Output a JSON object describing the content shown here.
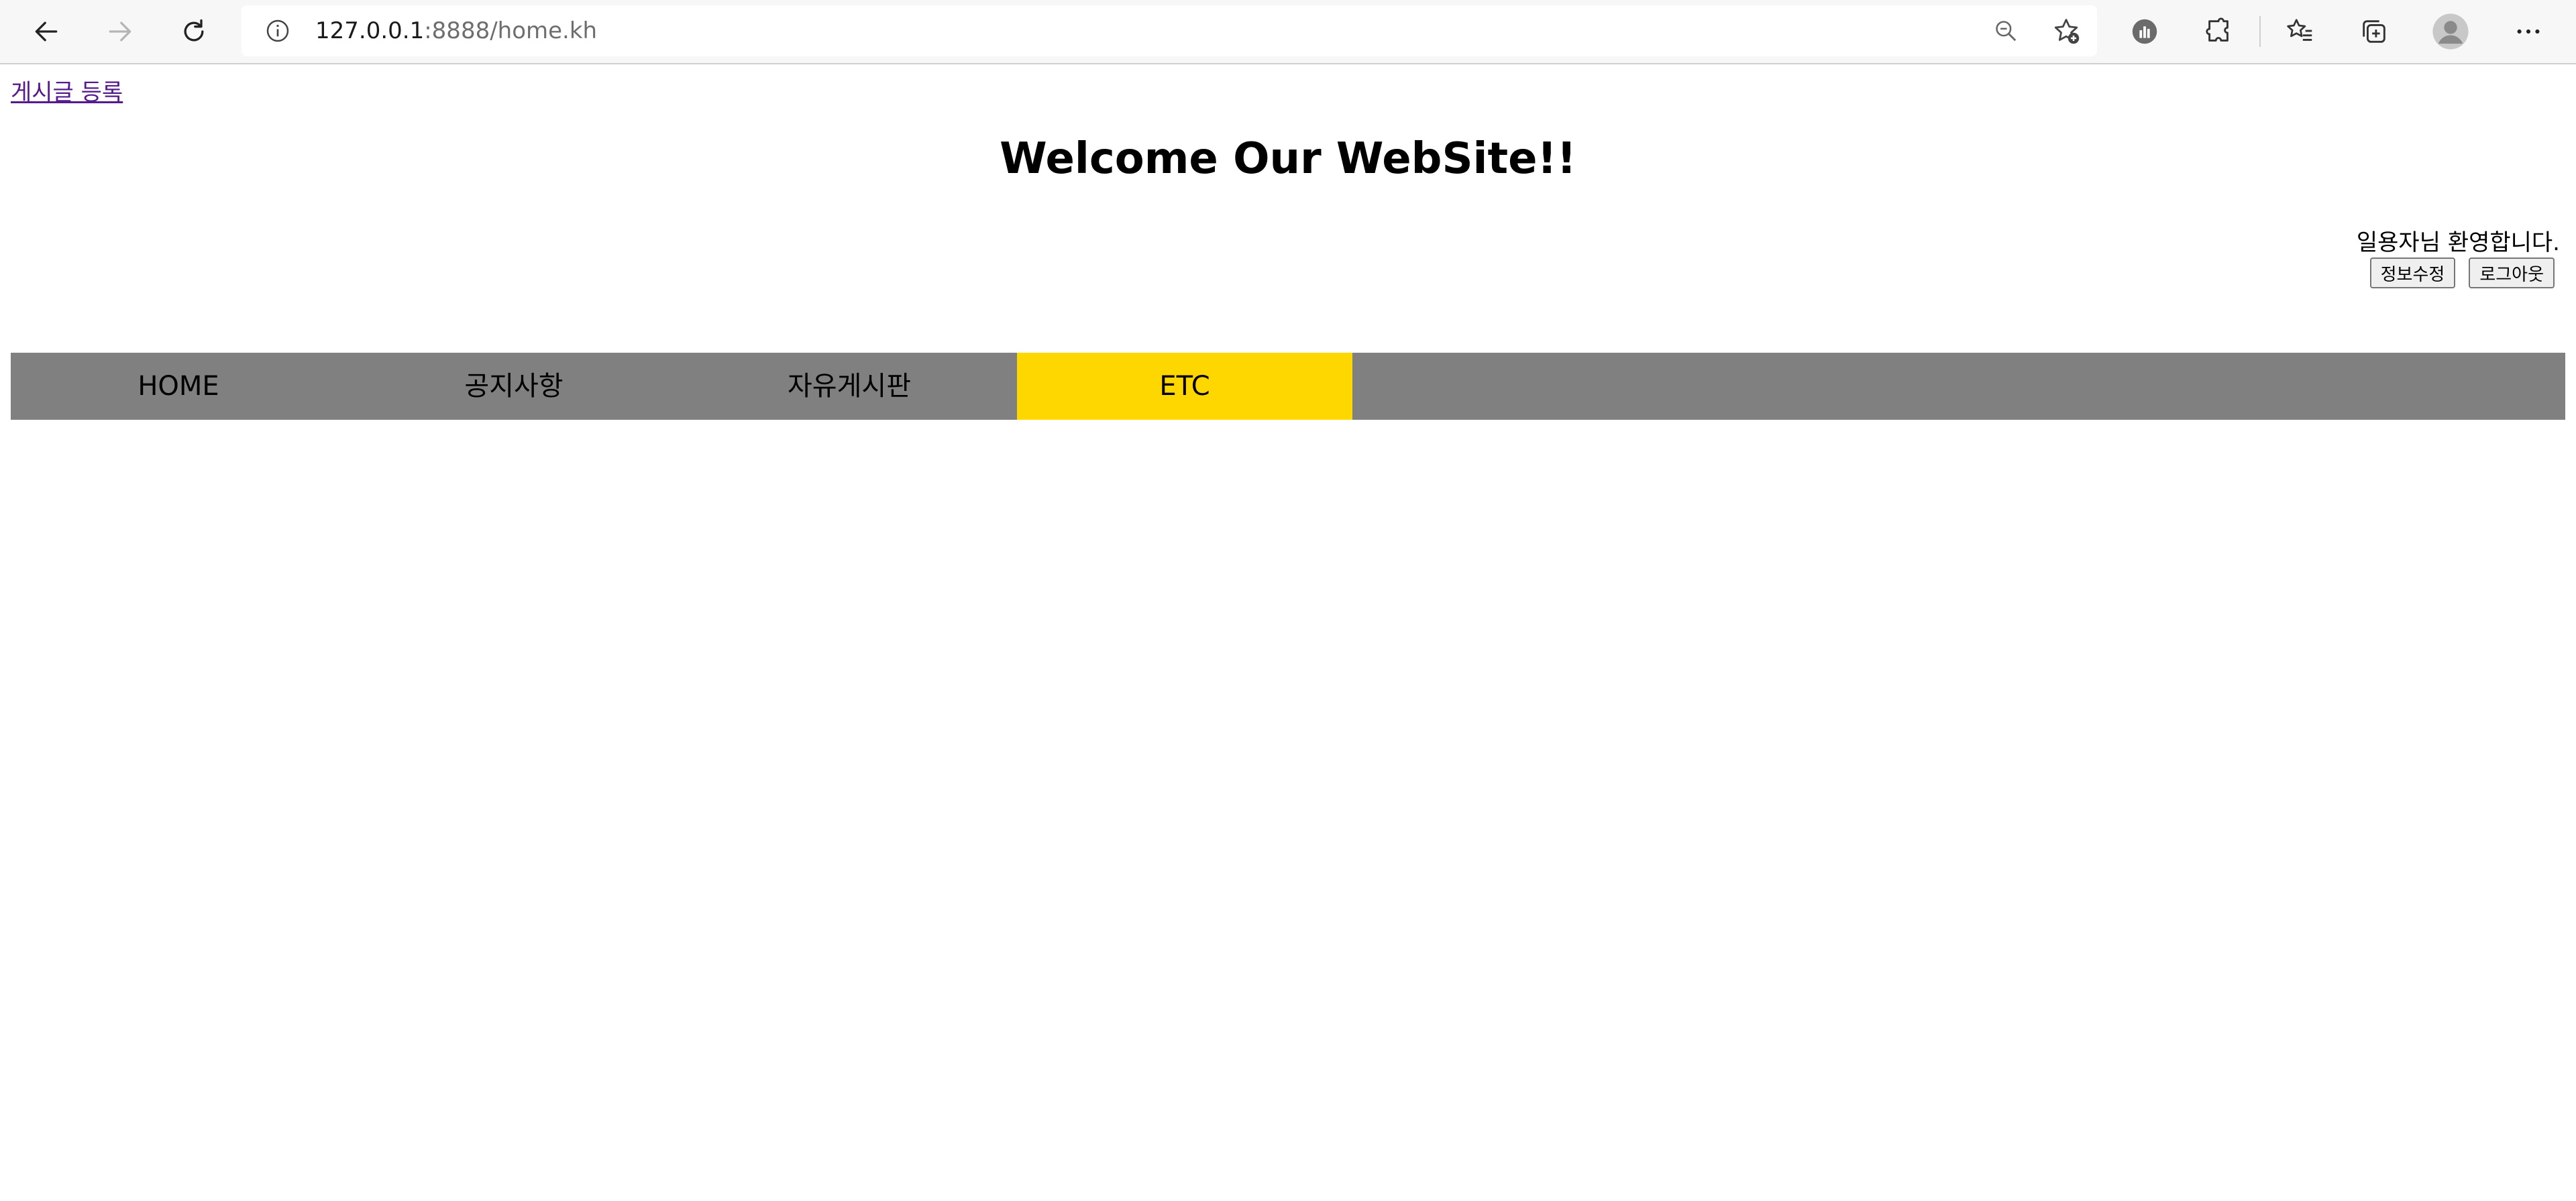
{
  "browser": {
    "url_host": "127.0.0.1",
    "url_rest": ":8888/home.kh",
    "icons": {
      "back": "back-arrow-icon",
      "forward": "forward-arrow-icon",
      "refresh": "refresh-icon",
      "info": "site-info-icon",
      "zoom": "zoom-out-icon",
      "favorite": "add-favorite-icon",
      "extension_a": "extension-badge-icon",
      "extensions": "puzzle-icon",
      "favorites": "favorites-icon",
      "collections": "collections-icon",
      "profile": "profile-avatar-icon",
      "menu": "more-menu-icon"
    }
  },
  "page": {
    "register_link": "게시글 등록",
    "title": "Welcome Our WebSite!!",
    "welcome": "일용자님 환영합니다.",
    "edit_button": "정보수정",
    "logout_button": "로그아웃",
    "nav": [
      {
        "label": "HOME",
        "active": false
      },
      {
        "label": "공지사항",
        "active": false
      },
      {
        "label": "자유게시판",
        "active": false
      },
      {
        "label": "ETC",
        "active": true
      }
    ]
  },
  "colors": {
    "nav_background": "#808080",
    "nav_active": "#ffd700",
    "visited_link": "#551a8b"
  }
}
